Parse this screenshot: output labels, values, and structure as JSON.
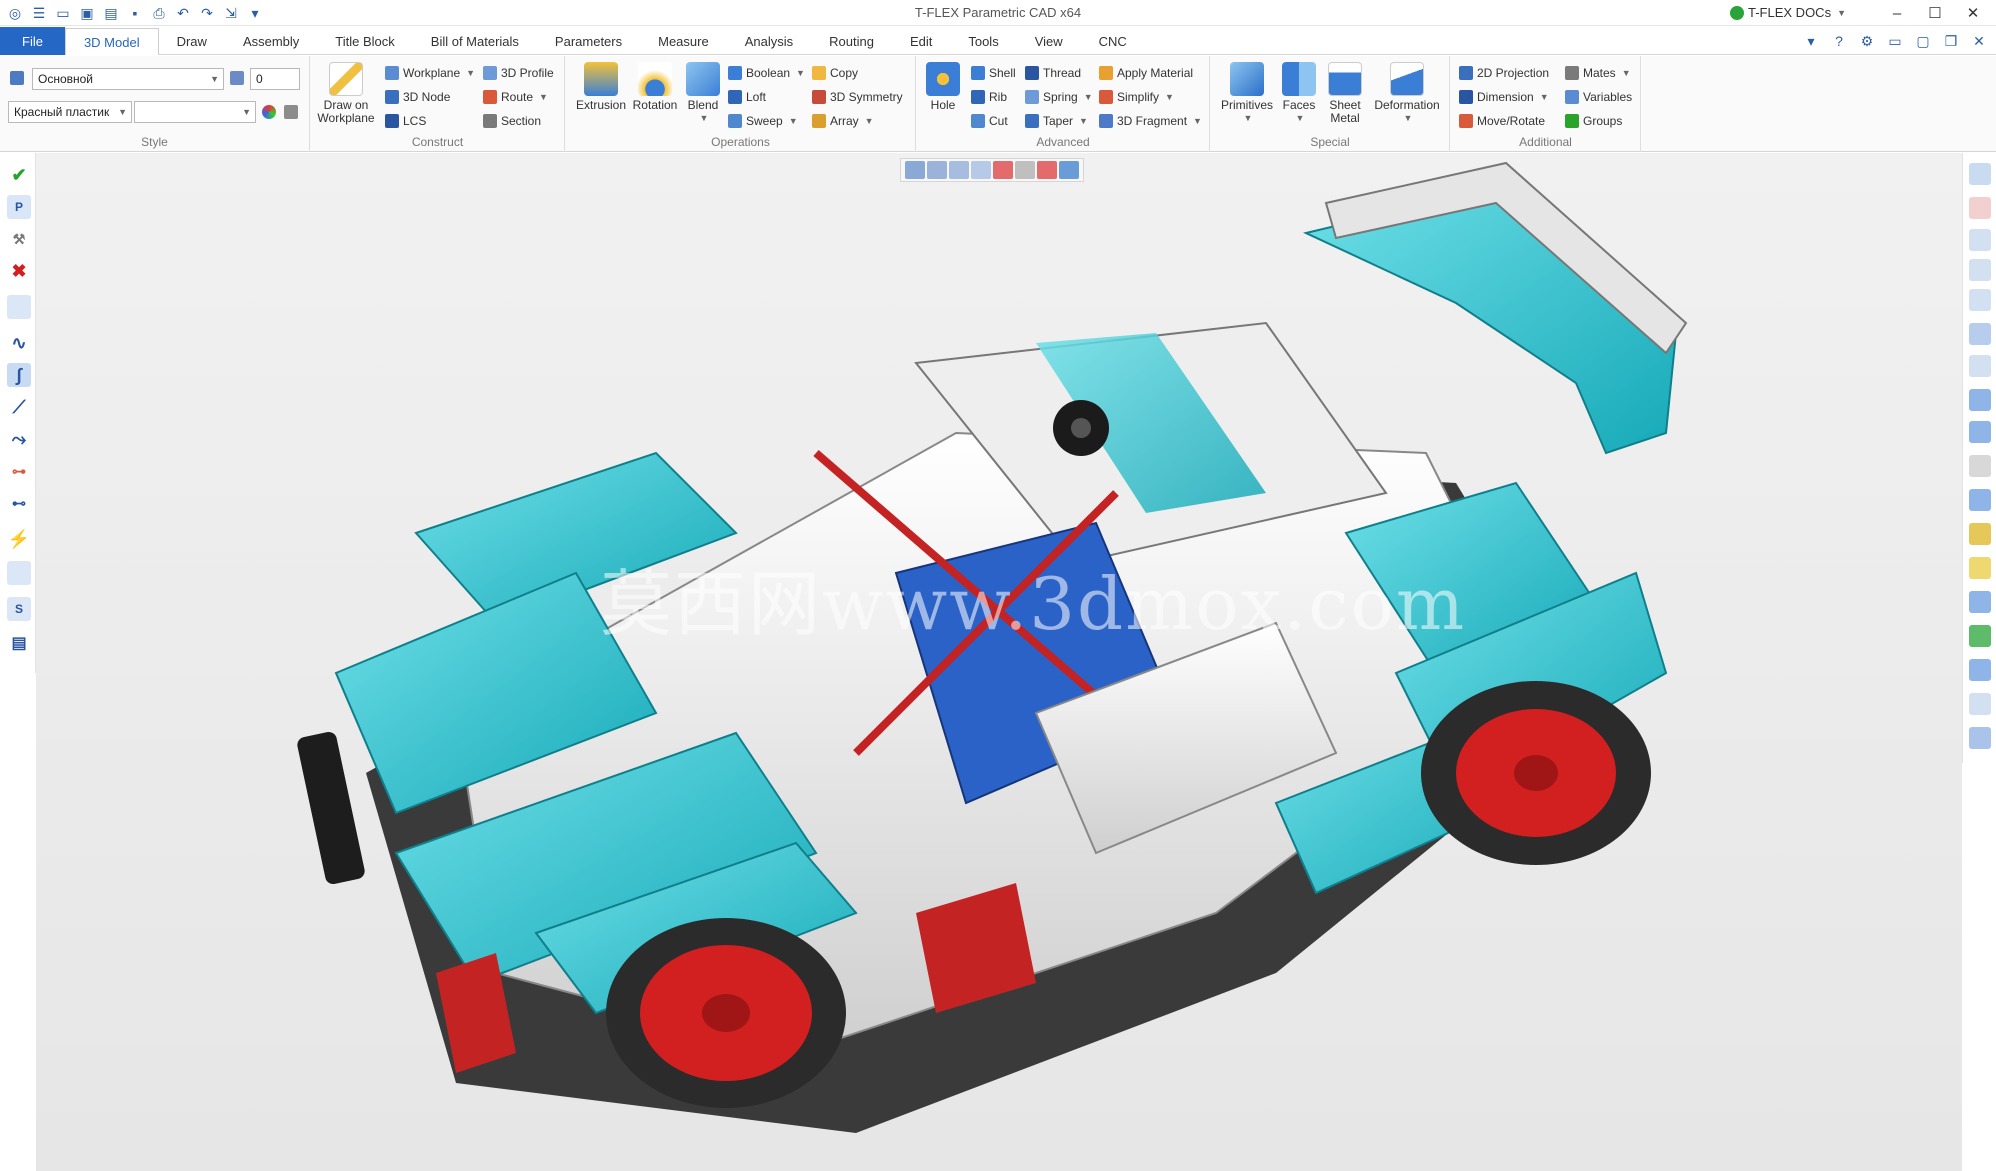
{
  "window": {
    "title": "T-FLEX Parametric CAD x64",
    "docs_label": "T-FLEX DOCs",
    "quick_access_icons": [
      "app-icon",
      "menu-icon",
      "new-icon",
      "new-assembly-icon",
      "open-icon",
      "save-icon",
      "print-icon",
      "undo-icon",
      "redo-icon",
      "export-icon",
      "customize-icon"
    ]
  },
  "tabs": [
    {
      "label": "File"
    },
    {
      "label": "3D Model"
    },
    {
      "label": "Draw"
    },
    {
      "label": "Assembly"
    },
    {
      "label": "Title Block"
    },
    {
      "label": "Bill of Materials"
    },
    {
      "label": "Parameters"
    },
    {
      "label": "Measure"
    },
    {
      "label": "Analysis"
    },
    {
      "label": "Routing"
    },
    {
      "label": "Edit"
    },
    {
      "label": "Tools"
    },
    {
      "label": "View"
    },
    {
      "label": "CNC"
    }
  ],
  "ribbon": {
    "style": {
      "label": "Style",
      "layer_value": "Основной",
      "level_value": "0",
      "material_value": "Красный пластик"
    },
    "construct": {
      "label": "Construct",
      "draw_on_workplane_1": "Draw on",
      "draw_on_workplane_2": "Workplane",
      "workplane": "Workplane",
      "node3d": "3D Node",
      "lcs": "LCS",
      "profile3d": "3D Profile",
      "route": "Route",
      "section": "Section"
    },
    "operations": {
      "label": "Operations",
      "extrusion": "Extrusion",
      "rotation": "Rotation",
      "blend": "Blend",
      "boolean": "Boolean",
      "loft": "Loft",
      "sweep": "Sweep",
      "copy": "Copy",
      "symmetry3d": "3D Symmetry",
      "array": "Array"
    },
    "advanced": {
      "label": "Advanced",
      "hole": "Hole",
      "shell": "Shell",
      "rib": "Rib",
      "cut": "Cut",
      "thread": "Thread",
      "spring": "Spring",
      "taper": "Taper",
      "apply_material": "Apply Material",
      "simplify": "Simplify",
      "fragment3d": "3D Fragment"
    },
    "special": {
      "label": "Special",
      "primitives": "Primitives",
      "faces": "Faces",
      "sheet_metal_1": "Sheet",
      "sheet_metal_2": "Metal",
      "deformation": "Deformation"
    },
    "additional": {
      "label": "Additional",
      "projection2d": "2D Projection",
      "dimension": "Dimension",
      "move_rotate": "Move/Rotate",
      "mates": "Mates",
      "variables": "Variables",
      "groups": "Groups"
    }
  },
  "viewport": {
    "watermark": "莫西网www.3dmox.com",
    "model": "lego-technic-rally-car",
    "body_color": "#2ec4cf",
    "wheel_rim_color": "#d21f1f"
  },
  "colors": {
    "accent": "#2567c4",
    "ok": "#29a329",
    "cancel": "#d22020"
  }
}
